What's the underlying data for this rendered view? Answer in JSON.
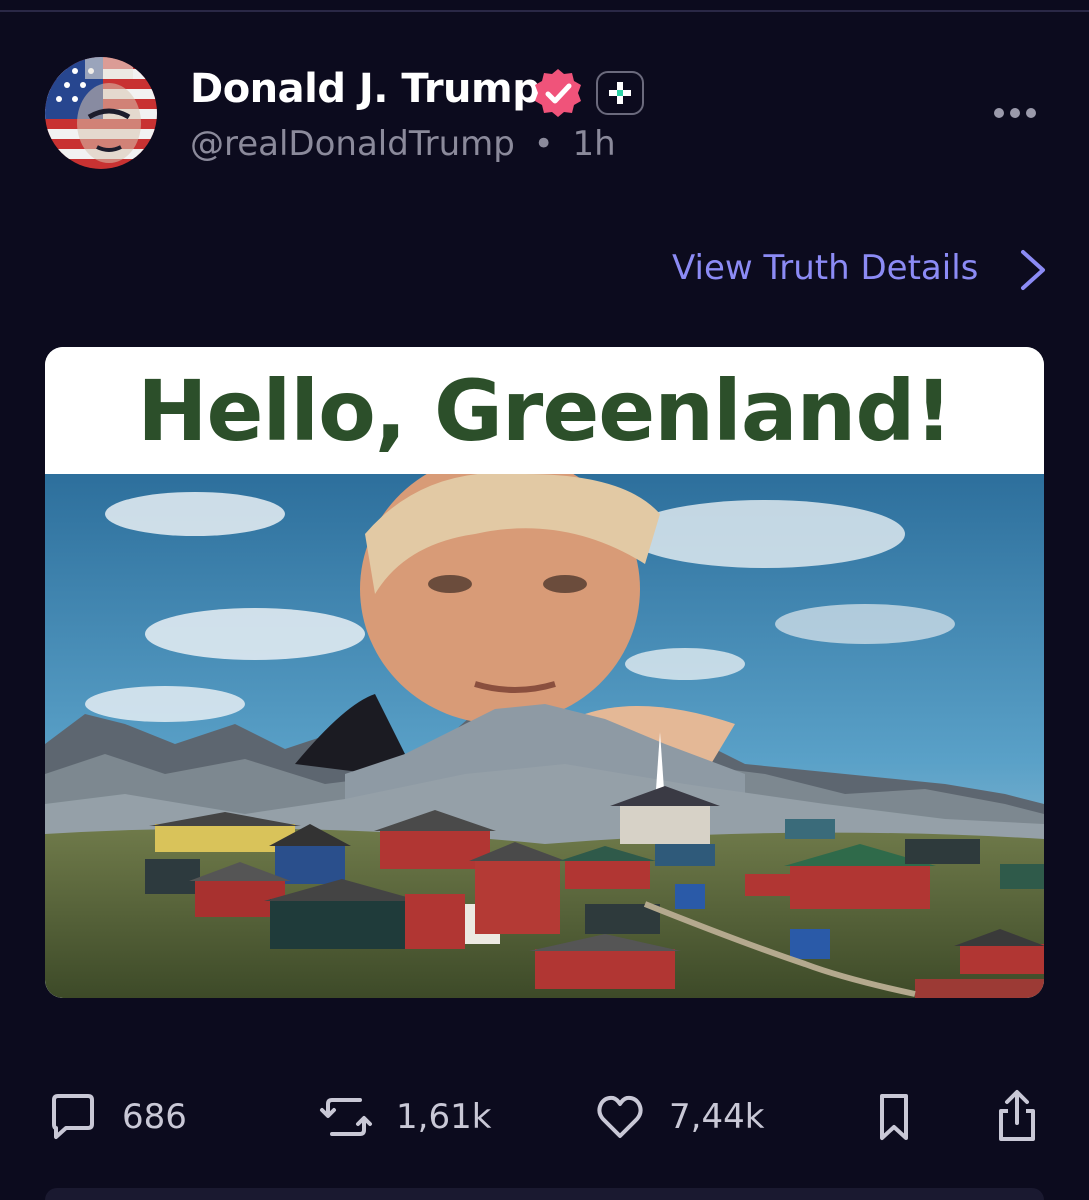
{
  "post": {
    "author": {
      "name": "Donald J. Trump",
      "handle": "@realDonaldTrump",
      "separator": "•",
      "time": "1h",
      "avatar_icon": "avatar-flag-portrait"
    },
    "view_details_label": "View Truth Details",
    "card": {
      "headline": "Hello, Greenland!",
      "image_icon": "greenland-collage-image"
    }
  },
  "actions": {
    "replies": "686",
    "retruths": "1,61k",
    "likes": "7,44k"
  },
  "colors": {
    "background": "#0c0b1e",
    "accent_link": "#8c8bf5",
    "verified_badge": "#f0537a",
    "headline_text": "#2c4f2a"
  }
}
